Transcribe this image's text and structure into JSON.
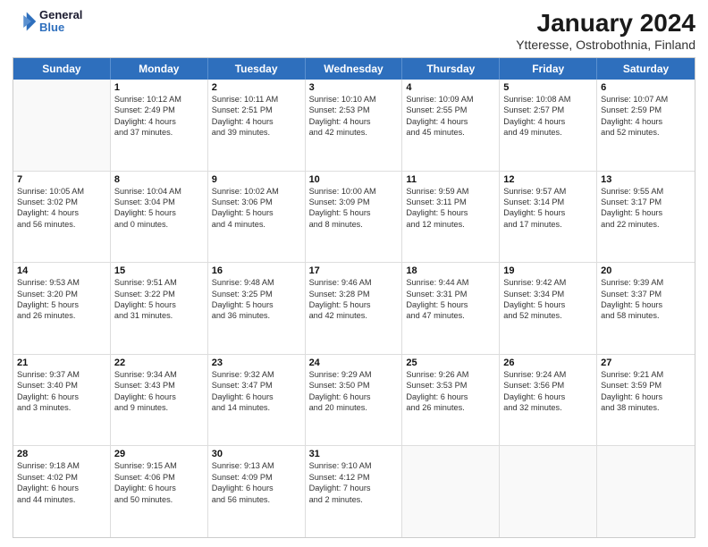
{
  "header": {
    "logo_line1": "General",
    "logo_line2": "Blue",
    "title": "January 2024",
    "subtitle": "Ytteresse, Ostrobothnia, Finland"
  },
  "days_of_week": [
    "Sunday",
    "Monday",
    "Tuesday",
    "Wednesday",
    "Thursday",
    "Friday",
    "Saturday"
  ],
  "weeks": [
    [
      {
        "day": "",
        "lines": []
      },
      {
        "day": "1",
        "lines": [
          "Sunrise: 10:12 AM",
          "Sunset: 2:49 PM",
          "Daylight: 4 hours",
          "and 37 minutes."
        ]
      },
      {
        "day": "2",
        "lines": [
          "Sunrise: 10:11 AM",
          "Sunset: 2:51 PM",
          "Daylight: 4 hours",
          "and 39 minutes."
        ]
      },
      {
        "day": "3",
        "lines": [
          "Sunrise: 10:10 AM",
          "Sunset: 2:53 PM",
          "Daylight: 4 hours",
          "and 42 minutes."
        ]
      },
      {
        "day": "4",
        "lines": [
          "Sunrise: 10:09 AM",
          "Sunset: 2:55 PM",
          "Daylight: 4 hours",
          "and 45 minutes."
        ]
      },
      {
        "day": "5",
        "lines": [
          "Sunrise: 10:08 AM",
          "Sunset: 2:57 PM",
          "Daylight: 4 hours",
          "and 49 minutes."
        ]
      },
      {
        "day": "6",
        "lines": [
          "Sunrise: 10:07 AM",
          "Sunset: 2:59 PM",
          "Daylight: 4 hours",
          "and 52 minutes."
        ]
      }
    ],
    [
      {
        "day": "7",
        "lines": [
          "Sunrise: 10:05 AM",
          "Sunset: 3:02 PM",
          "Daylight: 4 hours",
          "and 56 minutes."
        ]
      },
      {
        "day": "8",
        "lines": [
          "Sunrise: 10:04 AM",
          "Sunset: 3:04 PM",
          "Daylight: 5 hours",
          "and 0 minutes."
        ]
      },
      {
        "day": "9",
        "lines": [
          "Sunrise: 10:02 AM",
          "Sunset: 3:06 PM",
          "Daylight: 5 hours",
          "and 4 minutes."
        ]
      },
      {
        "day": "10",
        "lines": [
          "Sunrise: 10:00 AM",
          "Sunset: 3:09 PM",
          "Daylight: 5 hours",
          "and 8 minutes."
        ]
      },
      {
        "day": "11",
        "lines": [
          "Sunrise: 9:59 AM",
          "Sunset: 3:11 PM",
          "Daylight: 5 hours",
          "and 12 minutes."
        ]
      },
      {
        "day": "12",
        "lines": [
          "Sunrise: 9:57 AM",
          "Sunset: 3:14 PM",
          "Daylight: 5 hours",
          "and 17 minutes."
        ]
      },
      {
        "day": "13",
        "lines": [
          "Sunrise: 9:55 AM",
          "Sunset: 3:17 PM",
          "Daylight: 5 hours",
          "and 22 minutes."
        ]
      }
    ],
    [
      {
        "day": "14",
        "lines": [
          "Sunrise: 9:53 AM",
          "Sunset: 3:20 PM",
          "Daylight: 5 hours",
          "and 26 minutes."
        ]
      },
      {
        "day": "15",
        "lines": [
          "Sunrise: 9:51 AM",
          "Sunset: 3:22 PM",
          "Daylight: 5 hours",
          "and 31 minutes."
        ]
      },
      {
        "day": "16",
        "lines": [
          "Sunrise: 9:48 AM",
          "Sunset: 3:25 PM",
          "Daylight: 5 hours",
          "and 36 minutes."
        ]
      },
      {
        "day": "17",
        "lines": [
          "Sunrise: 9:46 AM",
          "Sunset: 3:28 PM",
          "Daylight: 5 hours",
          "and 42 minutes."
        ]
      },
      {
        "day": "18",
        "lines": [
          "Sunrise: 9:44 AM",
          "Sunset: 3:31 PM",
          "Daylight: 5 hours",
          "and 47 minutes."
        ]
      },
      {
        "day": "19",
        "lines": [
          "Sunrise: 9:42 AM",
          "Sunset: 3:34 PM",
          "Daylight: 5 hours",
          "and 52 minutes."
        ]
      },
      {
        "day": "20",
        "lines": [
          "Sunrise: 9:39 AM",
          "Sunset: 3:37 PM",
          "Daylight: 5 hours",
          "and 58 minutes."
        ]
      }
    ],
    [
      {
        "day": "21",
        "lines": [
          "Sunrise: 9:37 AM",
          "Sunset: 3:40 PM",
          "Daylight: 6 hours",
          "and 3 minutes."
        ]
      },
      {
        "day": "22",
        "lines": [
          "Sunrise: 9:34 AM",
          "Sunset: 3:43 PM",
          "Daylight: 6 hours",
          "and 9 minutes."
        ]
      },
      {
        "day": "23",
        "lines": [
          "Sunrise: 9:32 AM",
          "Sunset: 3:47 PM",
          "Daylight: 6 hours",
          "and 14 minutes."
        ]
      },
      {
        "day": "24",
        "lines": [
          "Sunrise: 9:29 AM",
          "Sunset: 3:50 PM",
          "Daylight: 6 hours",
          "and 20 minutes."
        ]
      },
      {
        "day": "25",
        "lines": [
          "Sunrise: 9:26 AM",
          "Sunset: 3:53 PM",
          "Daylight: 6 hours",
          "and 26 minutes."
        ]
      },
      {
        "day": "26",
        "lines": [
          "Sunrise: 9:24 AM",
          "Sunset: 3:56 PM",
          "Daylight: 6 hours",
          "and 32 minutes."
        ]
      },
      {
        "day": "27",
        "lines": [
          "Sunrise: 9:21 AM",
          "Sunset: 3:59 PM",
          "Daylight: 6 hours",
          "and 38 minutes."
        ]
      }
    ],
    [
      {
        "day": "28",
        "lines": [
          "Sunrise: 9:18 AM",
          "Sunset: 4:02 PM",
          "Daylight: 6 hours",
          "and 44 minutes."
        ]
      },
      {
        "day": "29",
        "lines": [
          "Sunrise: 9:15 AM",
          "Sunset: 4:06 PM",
          "Daylight: 6 hours",
          "and 50 minutes."
        ]
      },
      {
        "day": "30",
        "lines": [
          "Sunrise: 9:13 AM",
          "Sunset: 4:09 PM",
          "Daylight: 6 hours",
          "and 56 minutes."
        ]
      },
      {
        "day": "31",
        "lines": [
          "Sunrise: 9:10 AM",
          "Sunset: 4:12 PM",
          "Daylight: 7 hours",
          "and 2 minutes."
        ]
      },
      {
        "day": "",
        "lines": []
      },
      {
        "day": "",
        "lines": []
      },
      {
        "day": "",
        "lines": []
      }
    ]
  ]
}
